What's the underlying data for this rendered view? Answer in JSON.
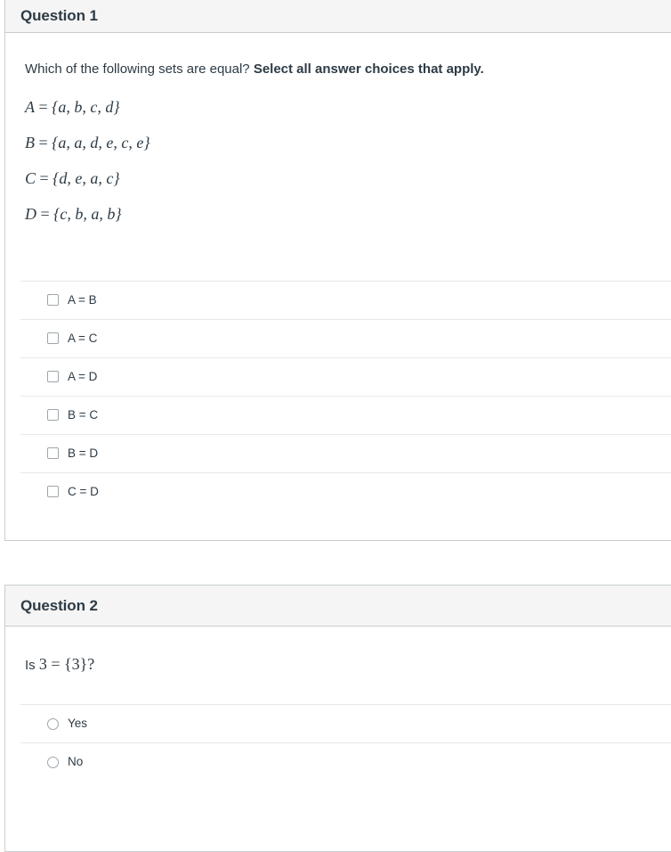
{
  "questions": [
    {
      "header": "Question 1",
      "prompt_plain": "Which of the following sets are equal? ",
      "prompt_bold": "Select all answer choices that apply.",
      "math_lines": [
        {
          "name": "A",
          "eq": "=",
          "set": "{a, b, c, d}"
        },
        {
          "name": "B",
          "eq": "=",
          "set": "{a, a, d, e, c, e}"
        },
        {
          "name": "C",
          "eq": "=",
          "set": "{d, e, a, c}"
        },
        {
          "name": "D",
          "eq": "=",
          "set": "{c, b, a, b}"
        }
      ],
      "input_type": "checkbox",
      "options": [
        {
          "label": "A = B",
          "checked": false
        },
        {
          "label": "A = C",
          "checked": false
        },
        {
          "label": "A = D",
          "checked": false
        },
        {
          "label": "B = C",
          "checked": false
        },
        {
          "label": "B = D",
          "checked": false
        },
        {
          "label": "C = D",
          "checked": false
        }
      ]
    },
    {
      "header": "Question 2",
      "prompt_plain": "Is ",
      "prompt_math": "3 = {3}?",
      "input_type": "radio",
      "options": [
        {
          "label": "Yes",
          "checked": false
        },
        {
          "label": "No",
          "checked": false
        }
      ]
    }
  ],
  "colors": {
    "text": "#2d3b45",
    "header_bg": "#f5f5f5",
    "box_border": "#c7cdd1",
    "row_divider": "#e6e8ea",
    "control_border": "#9ea6ab",
    "page_bg": "#ffffff"
  }
}
